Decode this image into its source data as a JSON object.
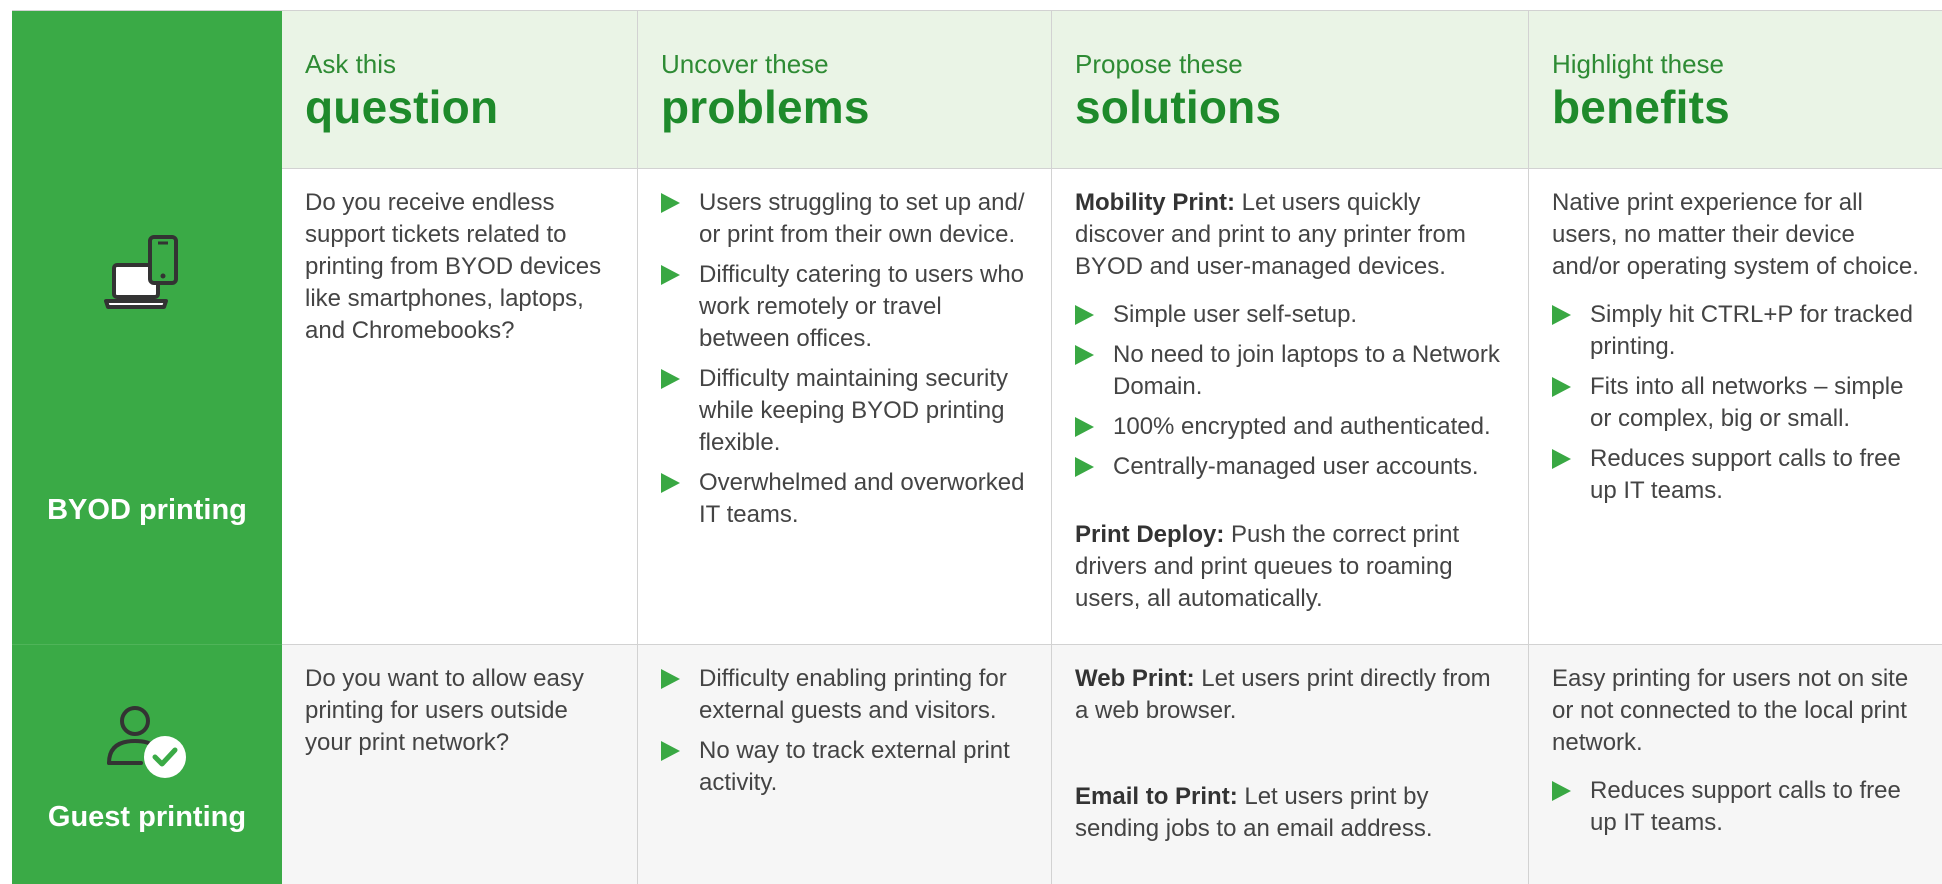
{
  "headers": [
    {
      "lead": "Ask  this",
      "big": "question"
    },
    {
      "lead": "Uncover these",
      "big": "problems"
    },
    {
      "lead": "Propose these",
      "big": "solutions"
    },
    {
      "lead": "Highlight these",
      "big": "benefits"
    }
  ],
  "rows": [
    {
      "label": "BYOD printing",
      "icon": "devices-icon",
      "question": "Do you receive endless support tickets related to printing from BYOD devices like smartphones, laptops, and Chromebooks?",
      "problems": [
        "Users struggling to set up and/ or print from their own device.",
        "Difficulty catering to users who work remotely or travel between offices.",
        "Difficulty maintaining security while keeping BYOD printing flexible.",
        "Overwhelmed and overworked IT teams."
      ],
      "solutions": {
        "s1_title": "Mobility Print:",
        "s1_text": " Let users quickly discover and print to any printer from BYOD and user-managed devices.",
        "s1_bullets": [
          "Simple user self-setup.",
          "No need to join laptops to a Network Domain.",
          "100% encrypted and authenticated.",
          "Centrally-managed user accounts."
        ],
        "s2_title": "Print Deploy:",
        "s2_text": " Push the correct print drivers and print queues to roaming users, all automatically."
      },
      "benefits": {
        "intro": "Native print experience for all users, no matter their device and/or operating system of choice.",
        "bullets": [
          "Simply hit CTRL+P for tracked printing.",
          "Fits into all networks – simple or complex, big or small.",
          "Reduces support calls to free up IT teams."
        ]
      }
    },
    {
      "label": "Guest printing",
      "icon": "guest-user-check-icon",
      "question": "Do you want to allow easy printing for users outside your print network?",
      "problems": [
        "Difficulty enabling printing for external guests and visitors.",
        "No way to track external print activity."
      ],
      "solutions": {
        "s1_title": "Web Print:",
        "s1_text": " Let users print directly from a web browser.",
        "s2_title": "Email to Print:",
        "s2_text": " Let users print by sending jobs to an email address."
      },
      "benefits": {
        "intro": "Easy printing for users not on site or not connected to the local print network.",
        "bullets": [
          "Reduces support calls to free up IT teams."
        ]
      }
    }
  ],
  "colors": {
    "green": "#3aaa46",
    "heading_green": "#1e8a2b",
    "header_bg": "#eaf4e6",
    "row2_bg": "#f6f6f6"
  }
}
